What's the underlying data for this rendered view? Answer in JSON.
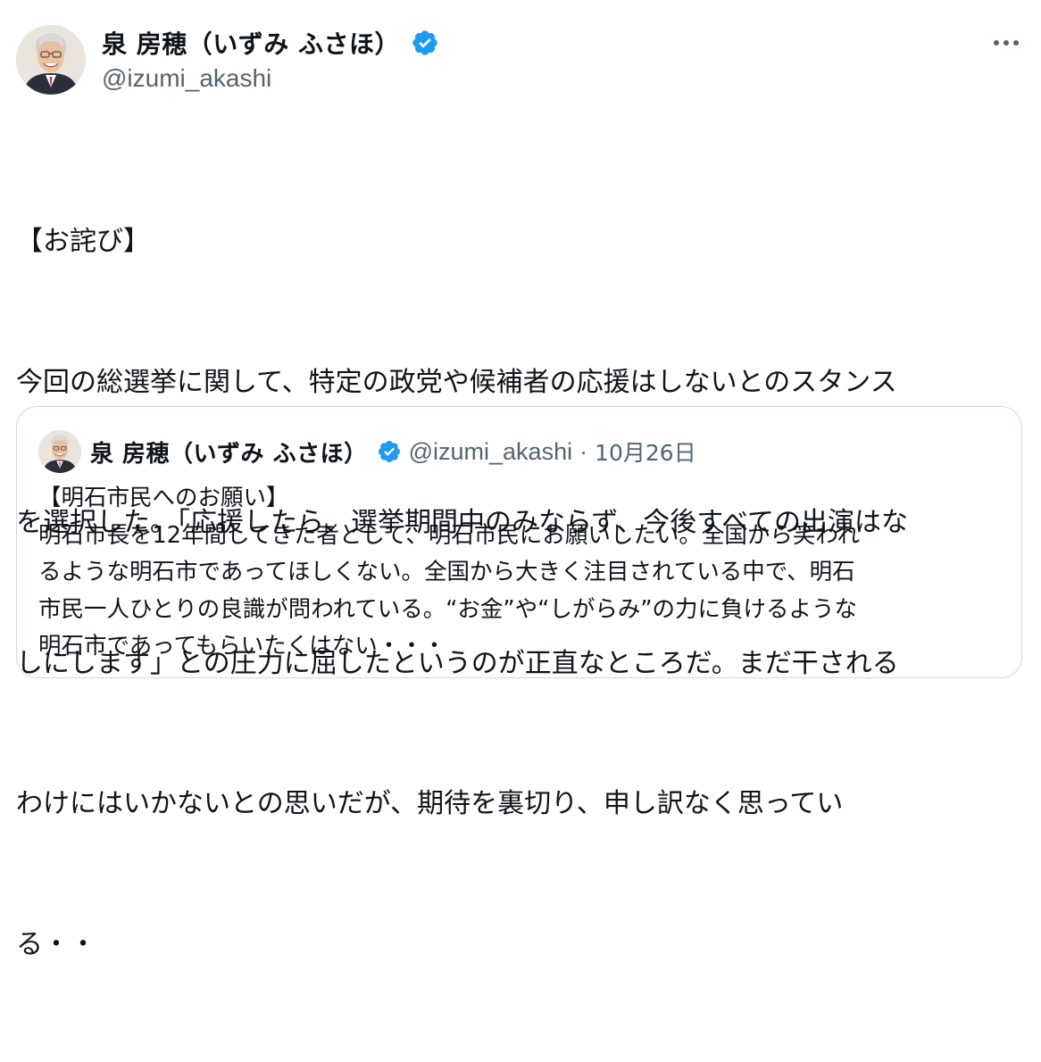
{
  "tweet": {
    "author": {
      "display_name": "泉 房穂（いずみ ふさほ）",
      "handle": "@izumi_akashi",
      "verified": true,
      "avatar_icon": "person-avatar"
    },
    "more_icon": "more-horizontal-icon",
    "body_lines": [
      "【お詫び】",
      "今回の総選挙に関して、特定の政党や候補者の応援はしないとのスタンス",
      "を選択した。「応援したら、選挙期間中のみならず、今後すべての出演はな",
      "しにします」との圧力に屈したというのが正直なところだ。まだ干される",
      "わけにはいかないとの思いだが、期待を裏切り、申し訳なく思ってい",
      "る・・"
    ]
  },
  "quote": {
    "author": {
      "display_name": "泉 房穂（いずみ ふさほ）",
      "handle": "@izumi_akashi",
      "separator": "·",
      "date": "10月26日",
      "verified": true
    },
    "body_lines": [
      "【明石市民へのお願い】",
      "明石市長を12年間してきた者として、明石市民にお願いしたい。全国から笑われ",
      "るような明石市であってほしくない。全国から大きく注目されている中で、明石",
      "市民一人ひとりの良識が問われている。“お金”や“しがらみ”の力に負けるような",
      "明石市であってもらいたくはない・・・"
    ]
  },
  "colors": {
    "text": "#0f1419",
    "secondary": "#536471",
    "verified_blue": "#1d9bf0",
    "border": "#cfd9de"
  }
}
